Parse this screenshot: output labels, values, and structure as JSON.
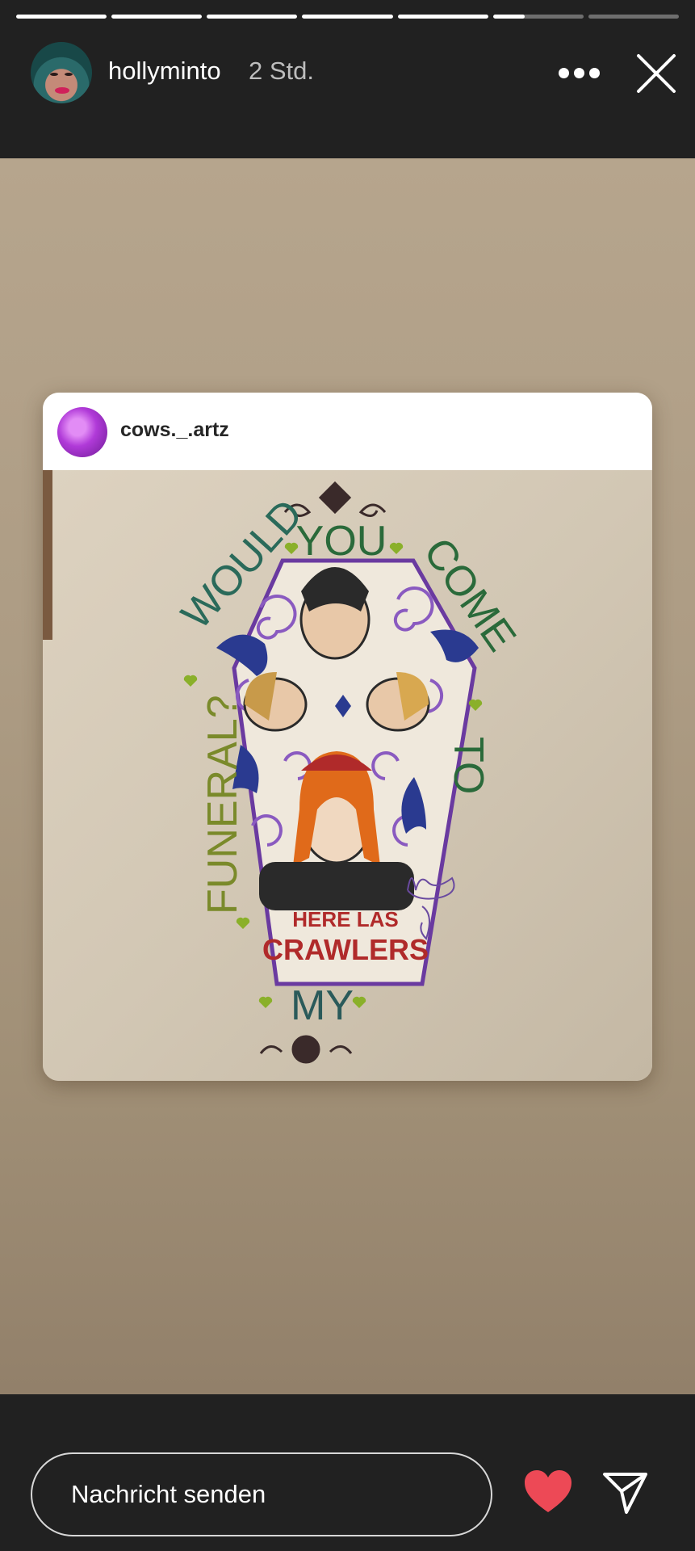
{
  "story": {
    "progress_segments": [
      1,
      1,
      1,
      1,
      1,
      0.35,
      0
    ],
    "username": "hollyminto",
    "timestamp": "2 Std."
  },
  "icons": {
    "more": "more-dots-icon",
    "close": "close-icon",
    "like": "heart-icon",
    "send": "paper-plane-icon"
  },
  "shared_post": {
    "username": "cows._.artz"
  },
  "artwork_text": {
    "top_left": "WOULD",
    "top_middle": "YOU",
    "top_right": "COME",
    "right": "TO",
    "left": "FUNERAL?",
    "bottom": "MY",
    "banner_line1": "HERE LAS",
    "banner_line2": "CRAWLERS"
  },
  "composer": {
    "placeholder": "Nachricht senden"
  },
  "colors": {
    "like": "#ed4956",
    "top_bar": "#212121",
    "story_bg": "#b0a08a"
  }
}
